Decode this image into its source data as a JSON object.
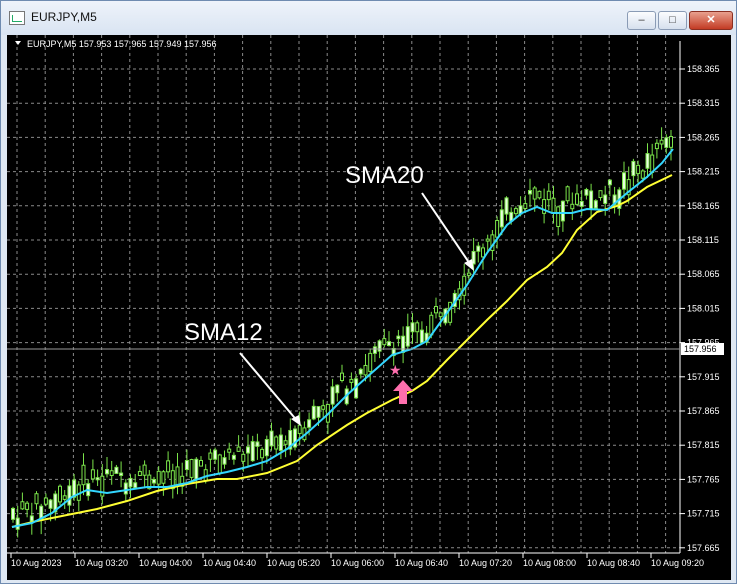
{
  "window": {
    "title": "EURJPY,M5",
    "minimize_glyph": "–",
    "maximize_glyph": "□",
    "close_glyph": "✕"
  },
  "chart": {
    "header": "EURJPY,M5  157.953 157.965 157.949 157.956",
    "current_price": "157.956",
    "price_labels": [
      "158.365",
      "158.315",
      "158.265",
      "158.215",
      "158.165",
      "158.115",
      "158.065",
      "158.015",
      "157.965",
      "157.915",
      "157.865",
      "157.815",
      "157.765",
      "157.715",
      "157.665"
    ],
    "time_labels": [
      "10 Aug 2023",
      "10 Aug 03:20",
      "10 Aug 04:00",
      "10 Aug 04:40",
      "10 Aug 05:20",
      "10 Aug 06:00",
      "10 Aug 06:40",
      "10 Aug 07:20",
      "10 Aug 08:00",
      "10 Aug 08:40",
      "10 Aug 09:20"
    ],
    "annotation_sma12": "SMA12",
    "annotation_sma20": "SMA20",
    "signal_star": "★",
    "colors": {
      "background": "#000000",
      "candle": "#7be44a",
      "sma12": "#33d6ff",
      "sma20": "#ffff33",
      "annotation": "#ffffff",
      "signal": "#ff6fae"
    }
  }
}
